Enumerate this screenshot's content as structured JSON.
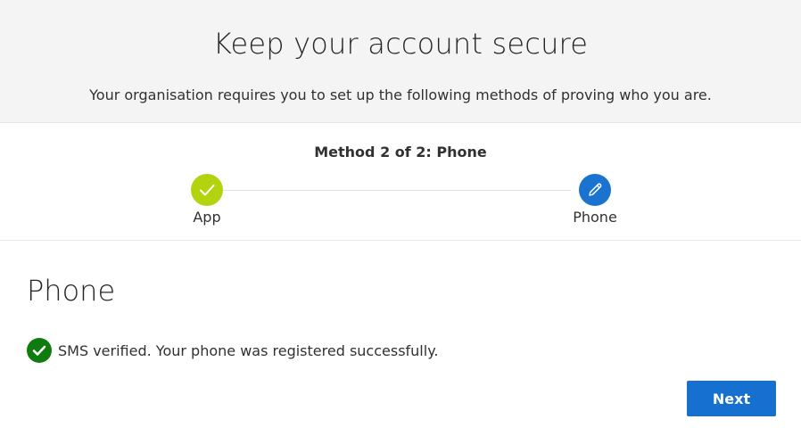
{
  "header": {
    "title": "Keep your account secure",
    "subtitle": "Your organisation requires you to set up the following methods of proving who you are."
  },
  "progress": {
    "method_label": "Method 2 of 2: Phone",
    "steps": [
      {
        "label": "App",
        "status": "complete",
        "icon": "checkmark-icon",
        "color": "#b4d30f"
      },
      {
        "label": "Phone",
        "status": "current",
        "icon": "pencil-icon",
        "color": "#1a73d0"
      }
    ]
  },
  "content": {
    "title": "Phone",
    "status_icon": "success-check-icon",
    "status_color": "#107c10",
    "status_text": "SMS verified. Your phone was registered successfully."
  },
  "actions": {
    "next_label": "Next",
    "accent_color": "#1570d0"
  }
}
